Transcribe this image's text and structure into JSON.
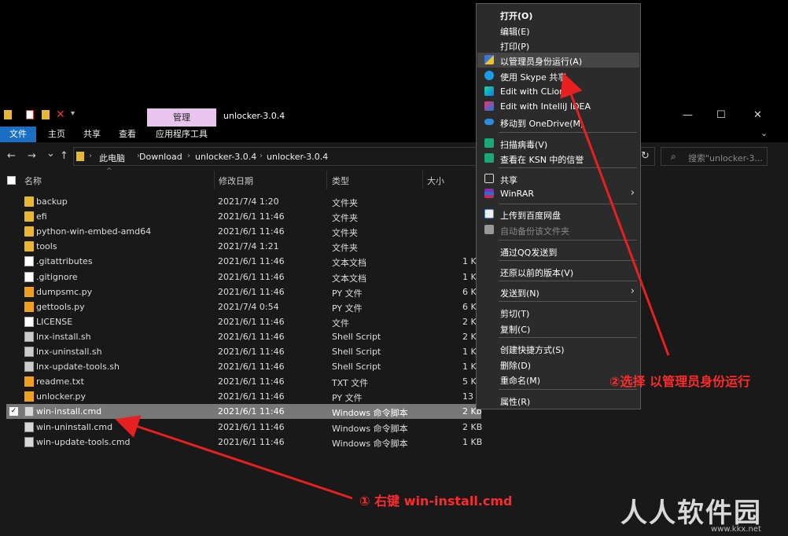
{
  "titlebar": {
    "manage_tab": "管理",
    "title": "unlocker-3.0.4",
    "minimize": "—",
    "maximize": "☐",
    "close": "✕"
  },
  "ribbon": {
    "file": "文件",
    "home": "主页",
    "share": "共享",
    "view": "查看",
    "app_tools": "应用程序工具"
  },
  "nav": {
    "back": "←",
    "forward": "→",
    "recent": "⌄",
    "up": "↑",
    "refresh": "↻"
  },
  "address": {
    "crumbs": [
      "此电脑",
      "Download",
      "unlocker-3.0.4",
      "unlocker-3.0.4"
    ]
  },
  "search": {
    "placeholder": "搜索\"unlocker-3..."
  },
  "columns": {
    "name": "名称",
    "modified": "修改日期",
    "type": "类型",
    "size": "大小"
  },
  "files": [
    {
      "name": "backup",
      "date": "2021/7/4 1:20",
      "type": "文件夹",
      "size": "",
      "icon": "folder"
    },
    {
      "name": "efi",
      "date": "2021/6/1 11:46",
      "type": "文件夹",
      "size": "",
      "icon": "folder"
    },
    {
      "name": "python-win-embed-amd64",
      "date": "2021/6/1 11:46",
      "type": "文件夹",
      "size": "",
      "icon": "folder"
    },
    {
      "name": "tools",
      "date": "2021/7/4 1:21",
      "type": "文件夹",
      "size": "",
      "icon": "folder"
    },
    {
      "name": ".gitattributes",
      "date": "2021/6/1 11:46",
      "type": "文本文档",
      "size": "1 K",
      "icon": "doc"
    },
    {
      "name": ".gitignore",
      "date": "2021/6/1 11:46",
      "type": "文本文档",
      "size": "1 K",
      "icon": "doc"
    },
    {
      "name": "dumpsmc.py",
      "date": "2021/6/1 11:46",
      "type": "PY 文件",
      "size": "6 K",
      "icon": "py"
    },
    {
      "name": "gettools.py",
      "date": "2021/7/4 0:54",
      "type": "PY 文件",
      "size": "6 K",
      "icon": "py"
    },
    {
      "name": "LICENSE",
      "date": "2021/6/1 11:46",
      "type": "文件",
      "size": "2 K",
      "icon": "doc"
    },
    {
      "name": "lnx-install.sh",
      "date": "2021/6/1 11:46",
      "type": "Shell Script",
      "size": "2 K",
      "icon": "sh"
    },
    {
      "name": "lnx-uninstall.sh",
      "date": "2021/6/1 11:46",
      "type": "Shell Script",
      "size": "1 K",
      "icon": "sh"
    },
    {
      "name": "lnx-update-tools.sh",
      "date": "2021/6/1 11:46",
      "type": "Shell Script",
      "size": "1 K",
      "icon": "sh"
    },
    {
      "name": "readme.txt",
      "date": "2021/6/1 11:46",
      "type": "TXT 文件",
      "size": "5 K",
      "icon": "py"
    },
    {
      "name": "unlocker.py",
      "date": "2021/6/1 11:46",
      "type": "PY 文件",
      "size": "13 K",
      "icon": "py"
    },
    {
      "name": "win-install.cmd",
      "date": "2021/6/1 11:46",
      "type": "Windows 命令脚本",
      "size": "2 Kb",
      "icon": "cmd",
      "selected": true
    },
    {
      "name": "win-uninstall.cmd",
      "date": "2021/6/1 11:46",
      "type": "Windows 命令脚本",
      "size": "2 KB",
      "icon": "cmd"
    },
    {
      "name": "win-update-tools.cmd",
      "date": "2021/6/1 11:46",
      "type": "Windows 命令脚本",
      "size": "1 KB",
      "icon": "cmd"
    }
  ],
  "context_menu": {
    "open": "打开(O)",
    "edit": "编辑(E)",
    "print": "打印(P)",
    "run_as_admin": "以管理员身份运行(A)",
    "skype": "使用 Skype 共享",
    "clion": "Edit with CLion",
    "idea": "Edit with IntelliJ IDEA",
    "onedrive": "移动到 OneDrive(M)",
    "scan": "扫描病毒(V)",
    "ksn": "查看在 KSN 中的信誉",
    "share": "共享",
    "winrar": "WinRAR",
    "baidu": "上传到百度网盘",
    "auto_backup": "自动备份该文件夹",
    "qq": "通过QQ发送到",
    "restore": "还原以前的版本(V)",
    "send_to": "发送到(N)",
    "cut": "剪切(T)",
    "copy": "复制(C)",
    "shortcut": "创建快捷方式(S)",
    "delete": "删除(D)",
    "rename": "重命名(M)",
    "properties": "属性(R)"
  },
  "annotations": {
    "step1": "① 右键 win-install.cmd",
    "step2": "②选择 以管理员身份运行"
  },
  "watermark": {
    "text": "人人软件园",
    "url": "www.kkx.net"
  }
}
